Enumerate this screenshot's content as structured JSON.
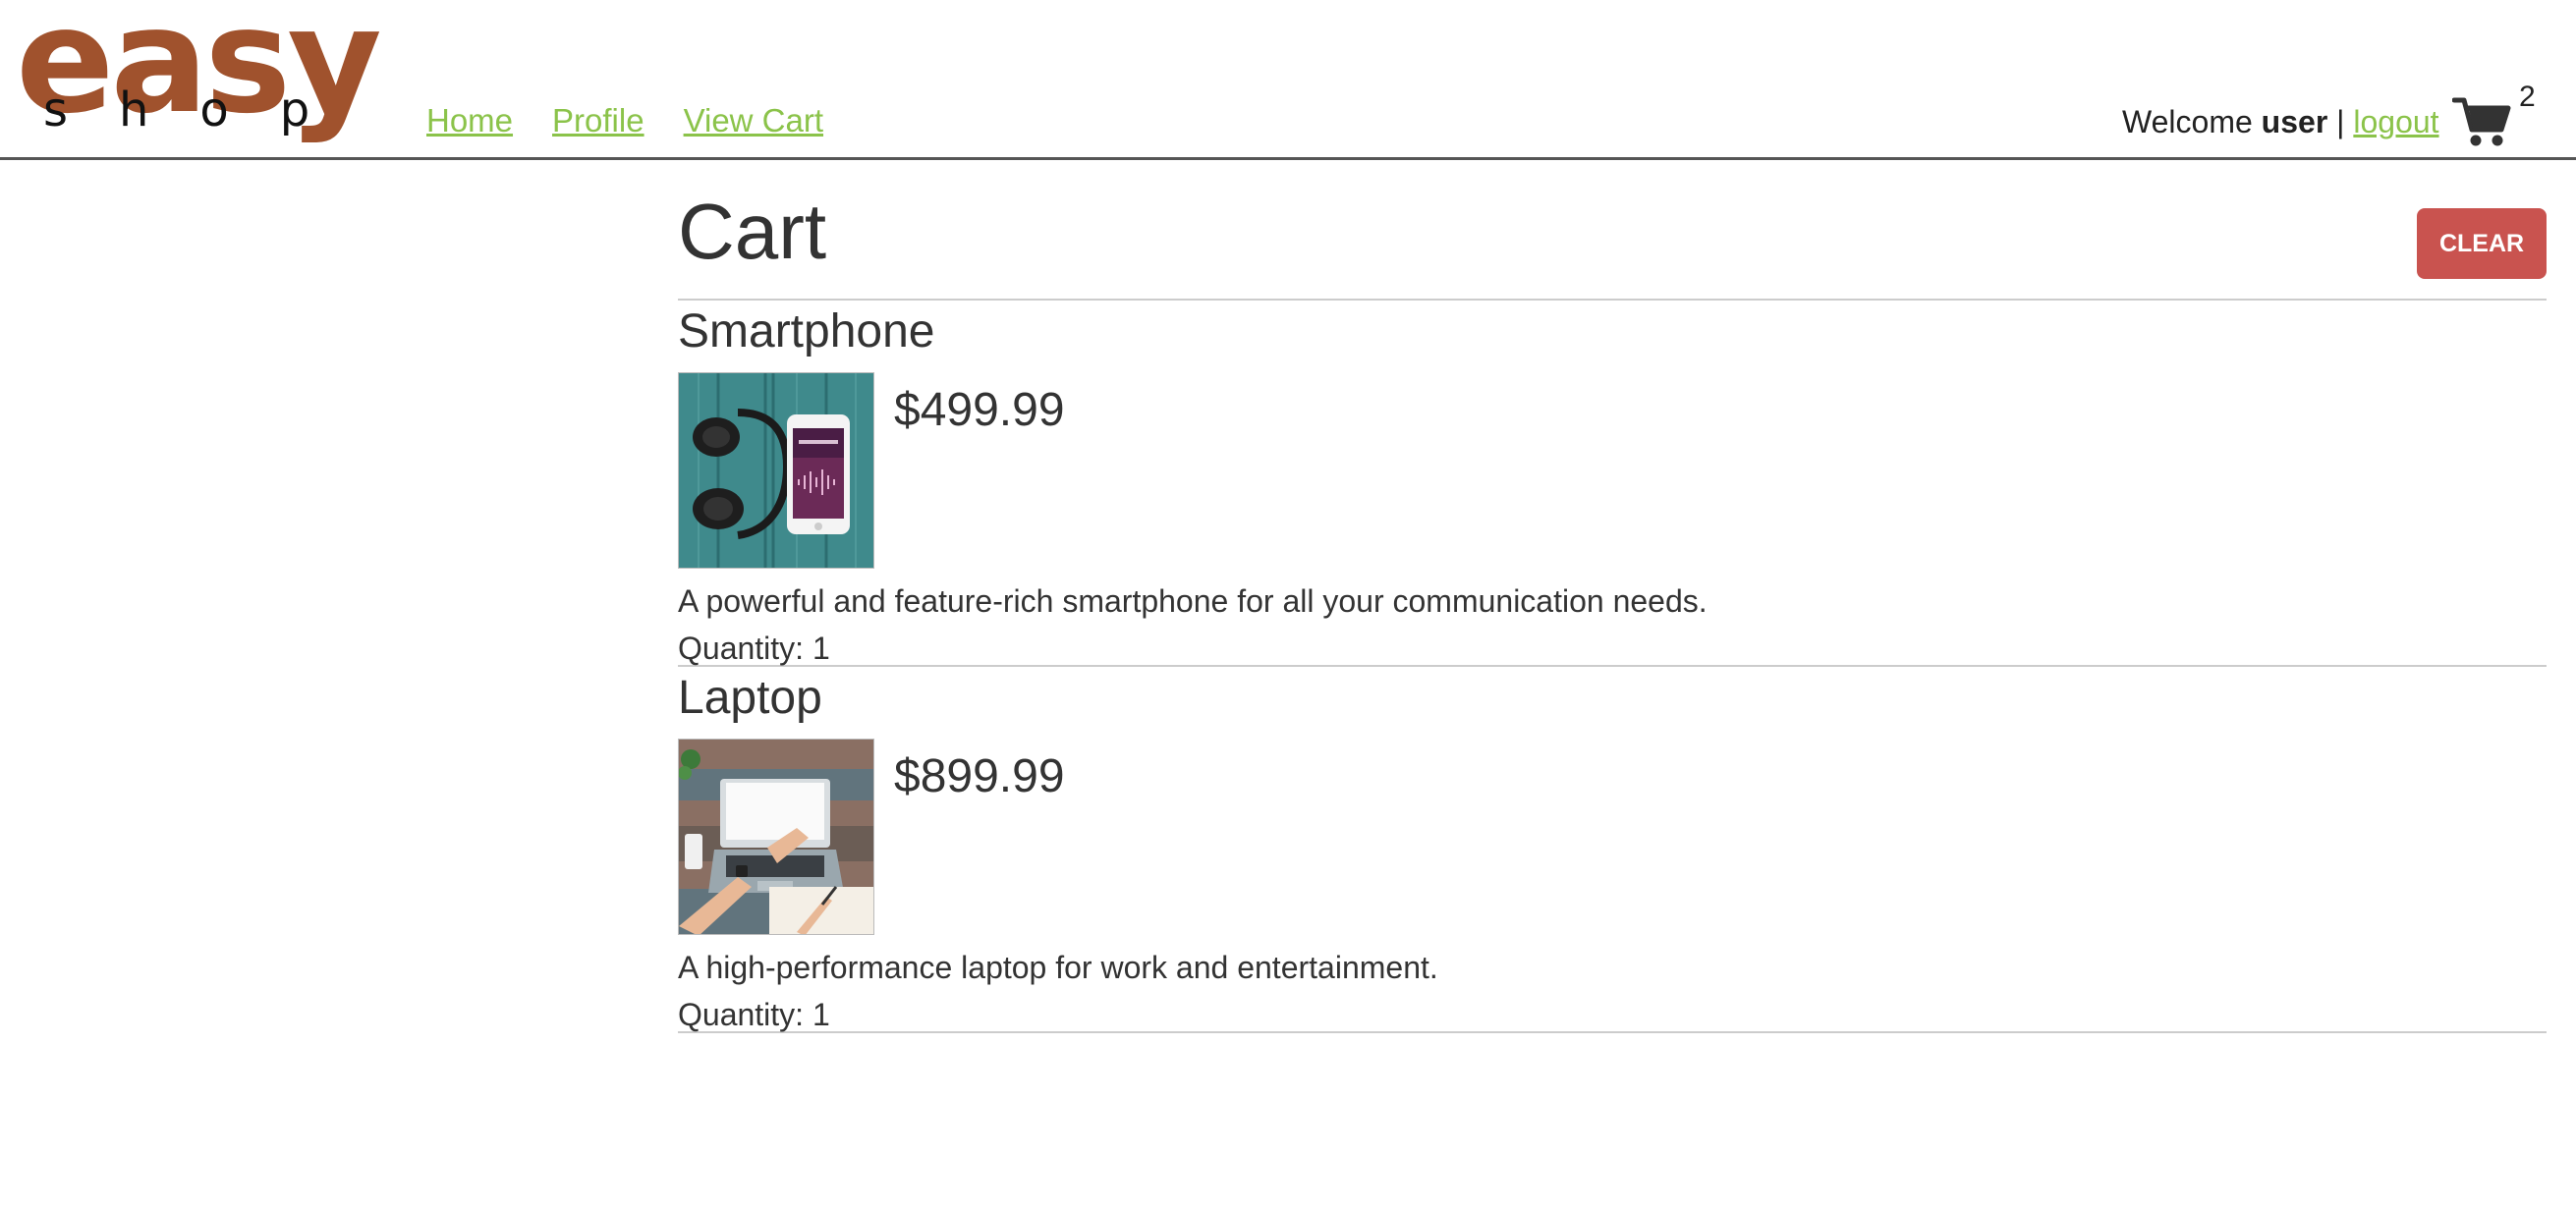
{
  "brand": {
    "line1": "easy",
    "line2": "shop"
  },
  "nav": [
    {
      "label": "Home"
    },
    {
      "label": "Profile"
    },
    {
      "label": "View Cart"
    }
  ],
  "user": {
    "welcome": "Welcome",
    "name": "user",
    "separator": "|",
    "logout": "logout"
  },
  "cart_badge": {
    "icon": "shopping-cart-icon",
    "count": "2"
  },
  "page": {
    "title": "Cart",
    "clear_label": "Clear"
  },
  "items": [
    {
      "name": "Smartphone",
      "price": "$499.99",
      "description": "A powerful and feature-rich smartphone for all your communication needs.",
      "quantity": "Quantity: 1"
    },
    {
      "name": "Laptop",
      "price": "$899.99",
      "description": "A high-performance laptop for work and entertainment.",
      "quantity": "Quantity: 1"
    }
  ],
  "colors": {
    "brand": "#a0522d",
    "link": "#8bc34a",
    "clear_button": "#c9534f",
    "text": "#333333"
  }
}
